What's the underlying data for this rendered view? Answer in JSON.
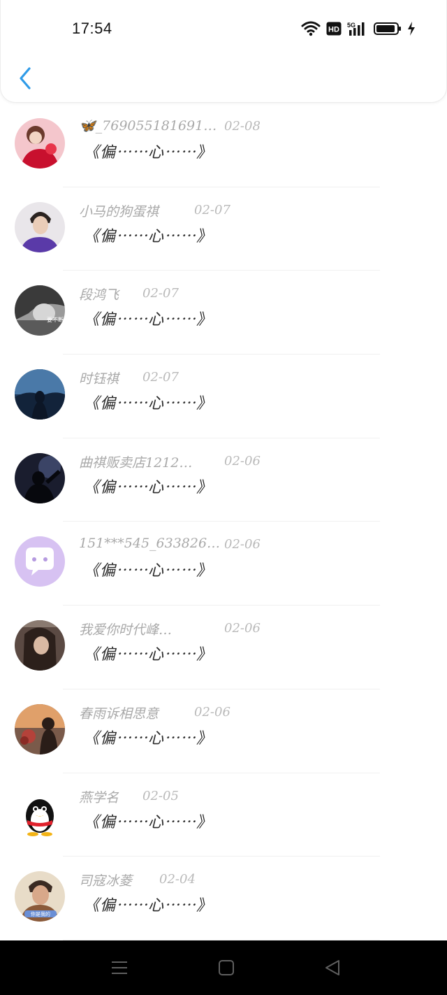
{
  "status_bar": {
    "time": "17:54",
    "icons": [
      "wifi-icon",
      "hd-icon",
      "signal-5g-icon",
      "battery-icon",
      "charging-icon"
    ],
    "hd_label": "HD",
    "network_label": "5G"
  },
  "header": {
    "back_icon": "chevron-left-icon",
    "accent_color": "#2f9be8"
  },
  "list": [
    {
      "name": "🦋_769055181691…",
      "date": "02-08",
      "message": "《偏⋯⋯心⋯⋯》"
    },
    {
      "name": "小马的狗蛋祺",
      "date": "02-07",
      "message": "《偏⋯⋯心⋯⋯》"
    },
    {
      "name": "段鸿飞",
      "date": "02-07",
      "message": "《偏⋯⋯心⋯⋯》"
    },
    {
      "name": "时钰祺",
      "date": "02-07",
      "message": "《偏⋯⋯心⋯⋯》"
    },
    {
      "name": "曲祺贩卖店1212…",
      "date": "02-06",
      "message": "《偏⋯⋯心⋯⋯》"
    },
    {
      "name": "151***545_633826…",
      "date": "02-06",
      "message": "《偏⋯⋯心⋯⋯》"
    },
    {
      "name": "我爱你时代峰…",
      "date": "02-06",
      "message": "《偏⋯⋯心⋯⋯》"
    },
    {
      "name": "春雨诉相思意",
      "date": "02-06",
      "message": "《偏⋯⋯心⋯⋯》"
    },
    {
      "name": "燕学名",
      "date": "02-05",
      "message": "《偏⋯⋯心⋯⋯》"
    },
    {
      "name": "司寇冰菱",
      "date": "02-04",
      "message": "《偏⋯⋯心⋯⋯》"
    }
  ],
  "avatar_overlay_texts": {
    "item3": "要不断",
    "item10": "你是我的"
  },
  "nav_bar": {
    "icons": [
      "menu-icon",
      "home-square-icon",
      "back-triangle-icon"
    ]
  }
}
